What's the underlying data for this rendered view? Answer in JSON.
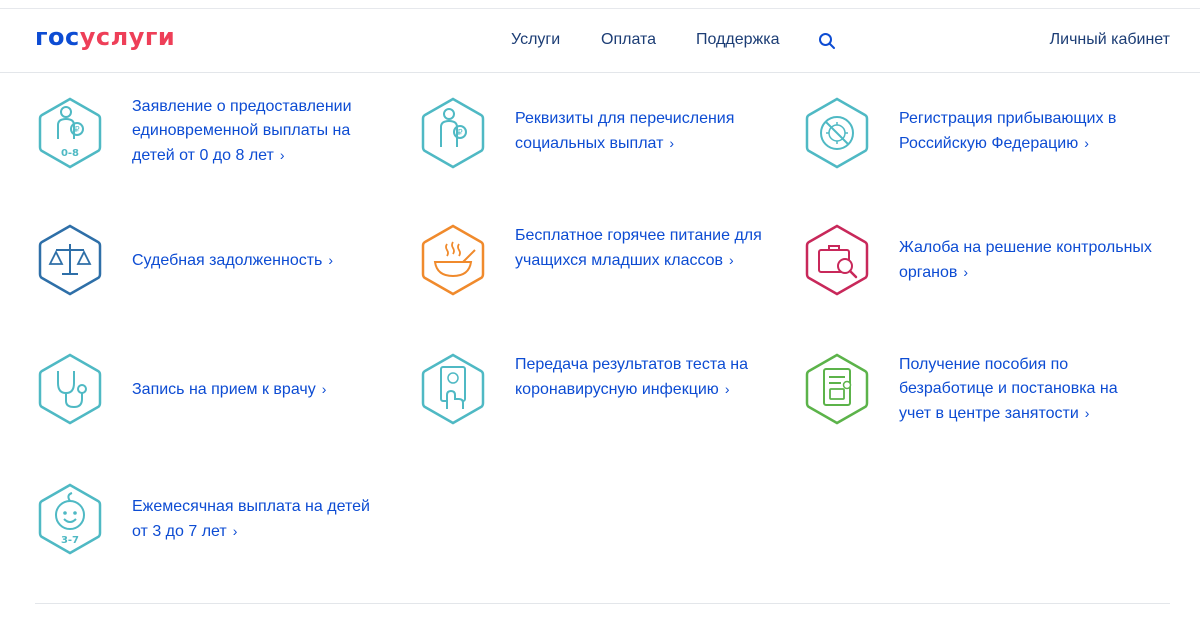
{
  "header": {
    "logo_part1": "гос",
    "logo_part2": "услуги",
    "nav": [
      "Услуги",
      "Оплата",
      "Поддержка"
    ],
    "cabinet": "Личный кабинет"
  },
  "services": [
    {
      "label": "Заявление о предоставлении единовременной выплаты на детей от 0 до 8 лет",
      "badge": "0-8",
      "icon": "child-payment-icon",
      "color": "#4fb9c4"
    },
    {
      "label": "Реквизиты для перечисления социальных выплат",
      "badge": "",
      "icon": "child-payment-icon",
      "color": "#4fb9c4"
    },
    {
      "label": "Регистрация прибывающих в Российскую Федерацию",
      "badge": "",
      "icon": "virus-icon",
      "color": "#4fb9c4"
    },
    {
      "label": "Судебная задолженность",
      "badge": "",
      "icon": "scales-icon",
      "color": "#2e6fa8"
    },
    {
      "label": "Бесплатное горячее питание для учащихся младших классов",
      "badge": "",
      "icon": "hot-food-icon",
      "color": "#f08a2c"
    },
    {
      "label": "Жалоба на решение контрольных органов",
      "badge": "",
      "icon": "briefcase-search-icon",
      "color": "#c8285a"
    },
    {
      "label": "Запись на прием к врачу",
      "badge": "",
      "icon": "stethoscope-icon",
      "color": "#4fb9c4"
    },
    {
      "label": "Передача результатов теста на коронавирусную инфекцию",
      "badge": "",
      "icon": "test-result-icon",
      "color": "#4fb9c4"
    },
    {
      "label": "Получение пособия по безработице и постановка на учет в центре занятости",
      "badge": "",
      "icon": "employment-document-icon",
      "color": "#5cb34a"
    },
    {
      "label": "Ежемесячная выплата на детей от 3 до 7 лет",
      "badge": "3-7",
      "icon": "baby-face-icon",
      "color": "#4fb9c4"
    }
  ]
}
